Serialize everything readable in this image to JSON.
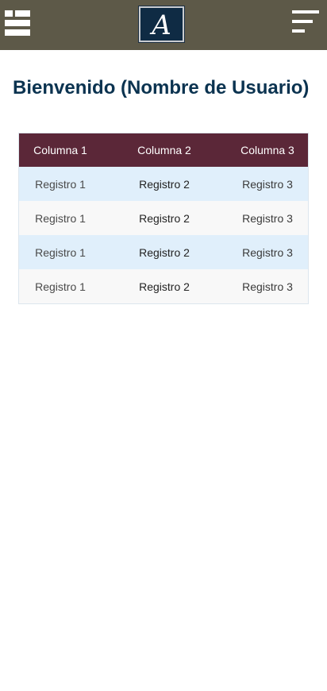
{
  "header": {
    "logo_letter": "A",
    "grid_icon": "grid-layout-icon",
    "menu_icon": "hamburger-menu-icon",
    "background_color": "#5d5948"
  },
  "main": {
    "welcome_text": "Bienvenido (Nombre de Usuario)",
    "title_color": "#0b3350"
  },
  "table": {
    "header_color": "#5b2738",
    "columns": [
      "Columna 1",
      "Columna 2",
      "Columna 3"
    ],
    "rows": [
      [
        "Registro 1",
        "Registro 2",
        "Registro 3"
      ],
      [
        "Registro 1",
        "Registro 2",
        "Registro 3"
      ],
      [
        "Registro 1",
        "Registro 2",
        "Registro 3"
      ],
      [
        "Registro 1",
        "Registro 2",
        "Registro 3"
      ]
    ]
  }
}
